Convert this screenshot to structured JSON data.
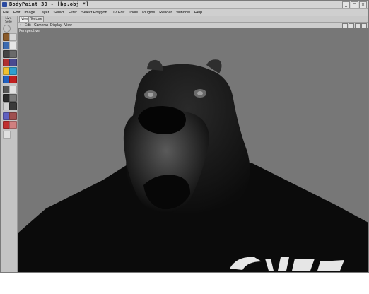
{
  "window": {
    "title": "BodyPaint 3D - [bp.obj *]",
    "controls": [
      "_",
      "□",
      "×"
    ]
  },
  "menu": [
    "File",
    "Edit",
    "Image",
    "Layer",
    "Select",
    "Filter",
    "Select Polygon",
    "UV Edit",
    "Tools",
    "Plugins",
    "Render",
    "Window",
    "Help"
  ],
  "toolbar": {
    "label": "Live Sele"
  },
  "tabs": {
    "view": "View",
    "texture": "Texture"
  },
  "viewport_menu": [
    "Edit",
    "Cameras",
    "Display",
    "View"
  ],
  "viewport": {
    "label": "Perspective"
  },
  "colors": {
    "viewport_bg": "#777777",
    "model": "#0c0c0c"
  }
}
